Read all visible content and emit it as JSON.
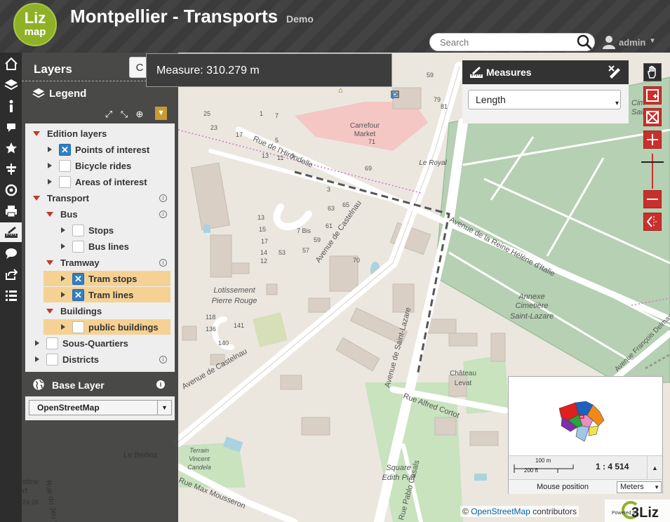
{
  "header": {
    "logo_line1": "Liz",
    "logo_line2": "map",
    "title": "Montpellier - Transports",
    "subtitle": "Demo",
    "search_placeholder": "Search",
    "user": "admin"
  },
  "iconbar": {
    "items": [
      "home-icon",
      "layers-icon",
      "info-icon",
      "comment-icon",
      "star-icon",
      "switcher-icon",
      "locate-icon",
      "print-icon",
      "measure-icon",
      "tooltip-icon",
      "share-icon",
      "list-icon"
    ],
    "active": "measure-icon"
  },
  "layers_panel": {
    "title": "Layers",
    "c_button": "C",
    "legend_title": "Legend",
    "tree": [
      {
        "label": "Edition layers",
        "type": "group",
        "expanded": true
      },
      {
        "label": "Points of interest",
        "checked": true
      },
      {
        "label": "Bicycle rides",
        "checked": false
      },
      {
        "label": "Areas of interest",
        "checked": false
      },
      {
        "label": "Transport",
        "type": "group",
        "expanded": true
      },
      {
        "label": "Bus",
        "type": "group",
        "expanded": true
      },
      {
        "label": "Stops",
        "checked": false
      },
      {
        "label": "Bus lines",
        "checked": false
      },
      {
        "label": "Tramway",
        "type": "group",
        "expanded": true
      },
      {
        "label": "Tram stops",
        "checked": true,
        "highlighted": true
      },
      {
        "label": "Tram lines",
        "checked": true,
        "highlighted": true
      },
      {
        "label": "Buildings",
        "type": "group",
        "expanded": true
      },
      {
        "label": "public buildings",
        "checked": false,
        "highlighted": true
      },
      {
        "label": "Sous-Quartiers",
        "checked": false
      },
      {
        "label": "Districts",
        "checked": false
      }
    ],
    "baselayer_title": "Base Layer",
    "baselayer_value": "OpenStreetMap"
  },
  "measure_tooltip": "Measure: 310.279 m",
  "measures_panel": {
    "title": "Measures",
    "type_value": "Length"
  },
  "overview": {
    "scale_m": "100 m",
    "scale_ft": "200 ft",
    "scale_ratio": "1 : 4 514",
    "mouse_position_label": "Mouse position",
    "unit_value": "Meters"
  },
  "attribution": {
    "prefix": "©",
    "link": "OpenStreetMap",
    "suffix": "contributors",
    "powered_small": "Powered by",
    "powered_brand": "3Liz"
  },
  "map_labels": {
    "streets": [
      "Rue de l'Hirondelle",
      "Avenue de Castelnau",
      "Avenue de la Reine Hélène d'Italie",
      "Avenue de Saint-Lazare",
      "Rue Alfred Cortot",
      "Rue Max Mousseron",
      "Rue Pablo Casals",
      "Avenue François Delmas",
      "Rue du Jeu de"
    ],
    "places": [
      "Carrefour Market",
      "Le Royal",
      "Lotissement Pierre Rouge",
      "Annexe Cimetière Saint-Lazare",
      "Château Levat",
      "Square Edith Piaf",
      "Terrain Vincent Candela",
      "Le Berlioz",
      "Cimetière Saint-Lazare"
    ],
    "numbers": [
      "59",
      "79",
      "81",
      "25",
      "23",
      "17",
      "7",
      "13",
      "11",
      "9",
      "71",
      "5",
      "69",
      "3",
      "63",
      "65",
      "1",
      "13",
      "15",
      "17",
      "7 Bis",
      "12",
      "14",
      "53",
      "57",
      "59",
      "61",
      "70",
      "118",
      "136",
      "140",
      "141",
      "24-26",
      "2"
    ]
  },
  "colors": {
    "accent_red": "#c9302c",
    "logo_green": "#8fb125",
    "highlight": "#f5d193",
    "checkbox_blue": "#2f7fc8"
  }
}
